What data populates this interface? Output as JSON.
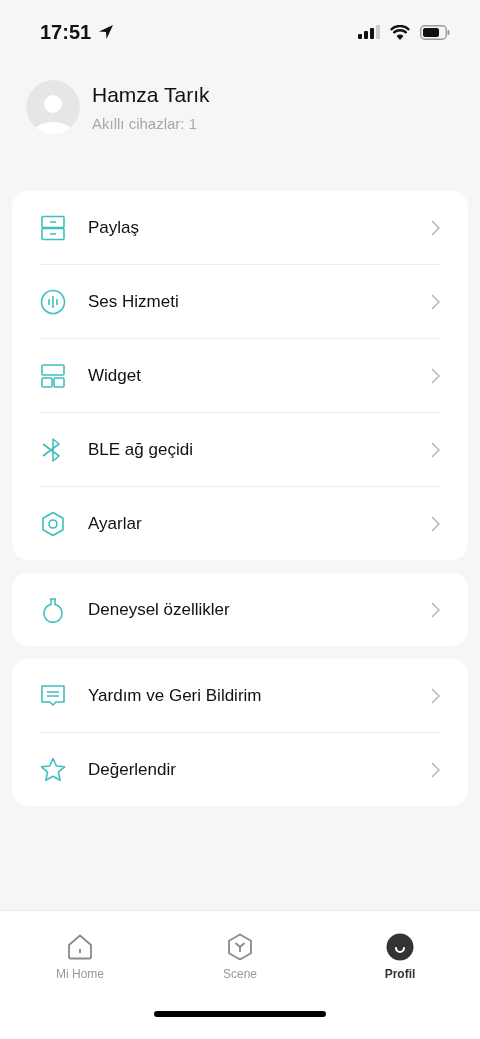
{
  "status_bar": {
    "time": "17:51"
  },
  "profile": {
    "name": "Hamza Tarık",
    "subtitle": "Akıllı cihazlar: 1"
  },
  "menu_groups": [
    {
      "items": [
        {
          "kind": "drawer",
          "label": "Paylaş"
        },
        {
          "kind": "voice",
          "label": "Ses Hizmeti"
        },
        {
          "kind": "widget",
          "label": "Widget"
        },
        {
          "kind": "bluetooth",
          "label": "BLE ağ geçidi"
        },
        {
          "kind": "hexagon",
          "label": "Ayarlar"
        }
      ]
    },
    {
      "items": [
        {
          "kind": "flask",
          "label": "Deneysel özellikler"
        }
      ]
    },
    {
      "items": [
        {
          "kind": "chat",
          "label": "Yardım ve Geri Bildirim"
        },
        {
          "kind": "star",
          "label": "Değerlendir"
        }
      ]
    }
  ],
  "tabs": [
    {
      "kind": "home",
      "label": "Mi Home",
      "selected": false
    },
    {
      "kind": "scene",
      "label": "Scene",
      "selected": false
    },
    {
      "kind": "profile",
      "label": "Profil",
      "selected": true
    }
  ]
}
